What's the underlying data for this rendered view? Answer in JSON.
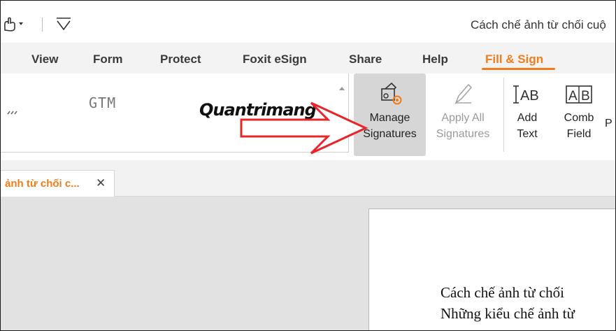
{
  "window": {
    "title": "Cách chế ảnh từ chối cuộ"
  },
  "menu": {
    "tabs": [
      {
        "label": "View"
      },
      {
        "label": "Form"
      },
      {
        "label": "Protect"
      },
      {
        "label": "Foxit eSign"
      },
      {
        "label": "Share"
      },
      {
        "label": "Help"
      },
      {
        "label": "Fill & Sign",
        "active": true
      }
    ]
  },
  "ribbon": {
    "manage_signatures": {
      "line1": "Manage",
      "line2": "Signatures"
    },
    "apply_all_signatures": {
      "line1": "Apply All",
      "line2": "Signatures"
    },
    "add_text": {
      "line1": "Add",
      "line2": "Text"
    },
    "comb_field": {
      "line1": "Comb",
      "line2": "Field"
    },
    "partial": "P",
    "signature_gallery": {
      "sig_initials": "GTM",
      "sig_logo": "Quantrimang"
    }
  },
  "document_tab": {
    "label": "ảnh từ chối c...",
    "close": "✕"
  },
  "page": {
    "lines": [
      "Cách chế ảnh từ chối",
      "Những kiểu chế ảnh từ"
    ]
  },
  "colors": {
    "accent": "#f07c1a",
    "arrow": "#e8262a"
  }
}
